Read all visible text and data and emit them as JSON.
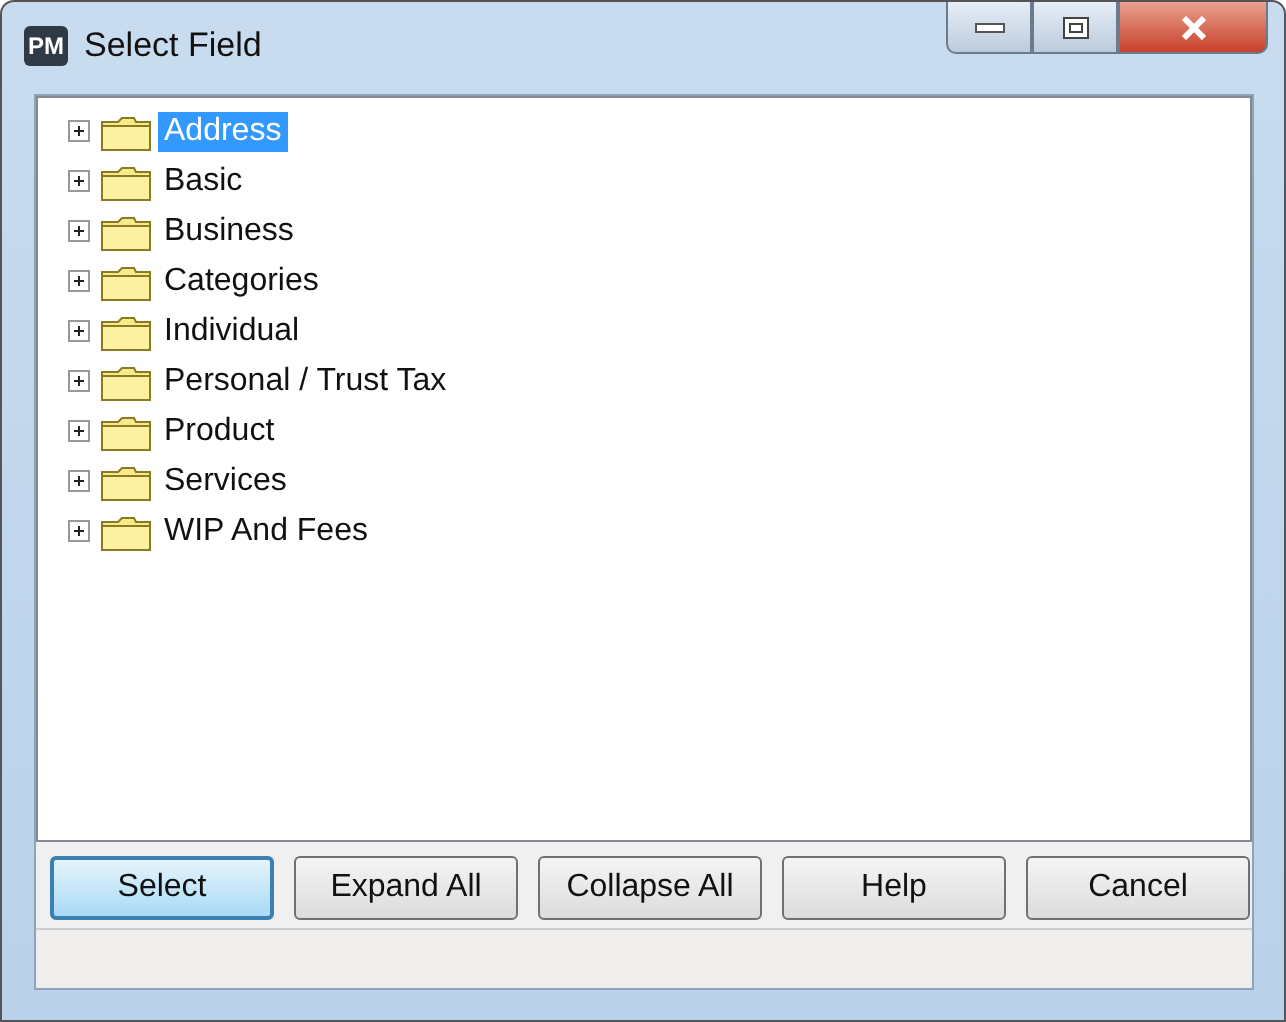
{
  "window": {
    "app_badge": "PM",
    "title": "Select Field"
  },
  "tree": {
    "items": [
      {
        "label": "Address",
        "selected": true,
        "expanded": false
      },
      {
        "label": "Basic",
        "selected": false,
        "expanded": false
      },
      {
        "label": "Business",
        "selected": false,
        "expanded": false
      },
      {
        "label": "Categories",
        "selected": false,
        "expanded": false
      },
      {
        "label": "Individual",
        "selected": false,
        "expanded": false
      },
      {
        "label": "Personal / Trust Tax",
        "selected": false,
        "expanded": false
      },
      {
        "label": "Product",
        "selected": false,
        "expanded": false
      },
      {
        "label": "Services",
        "selected": false,
        "expanded": false
      },
      {
        "label": "WIP And Fees",
        "selected": false,
        "expanded": false
      }
    ]
  },
  "buttons": [
    {
      "label": "Select",
      "focused": true
    },
    {
      "label": "Expand All",
      "focused": false
    },
    {
      "label": "Collapse All",
      "focused": false
    },
    {
      "label": "Help",
      "focused": false
    },
    {
      "label": "Cancel",
      "focused": false
    }
  ]
}
